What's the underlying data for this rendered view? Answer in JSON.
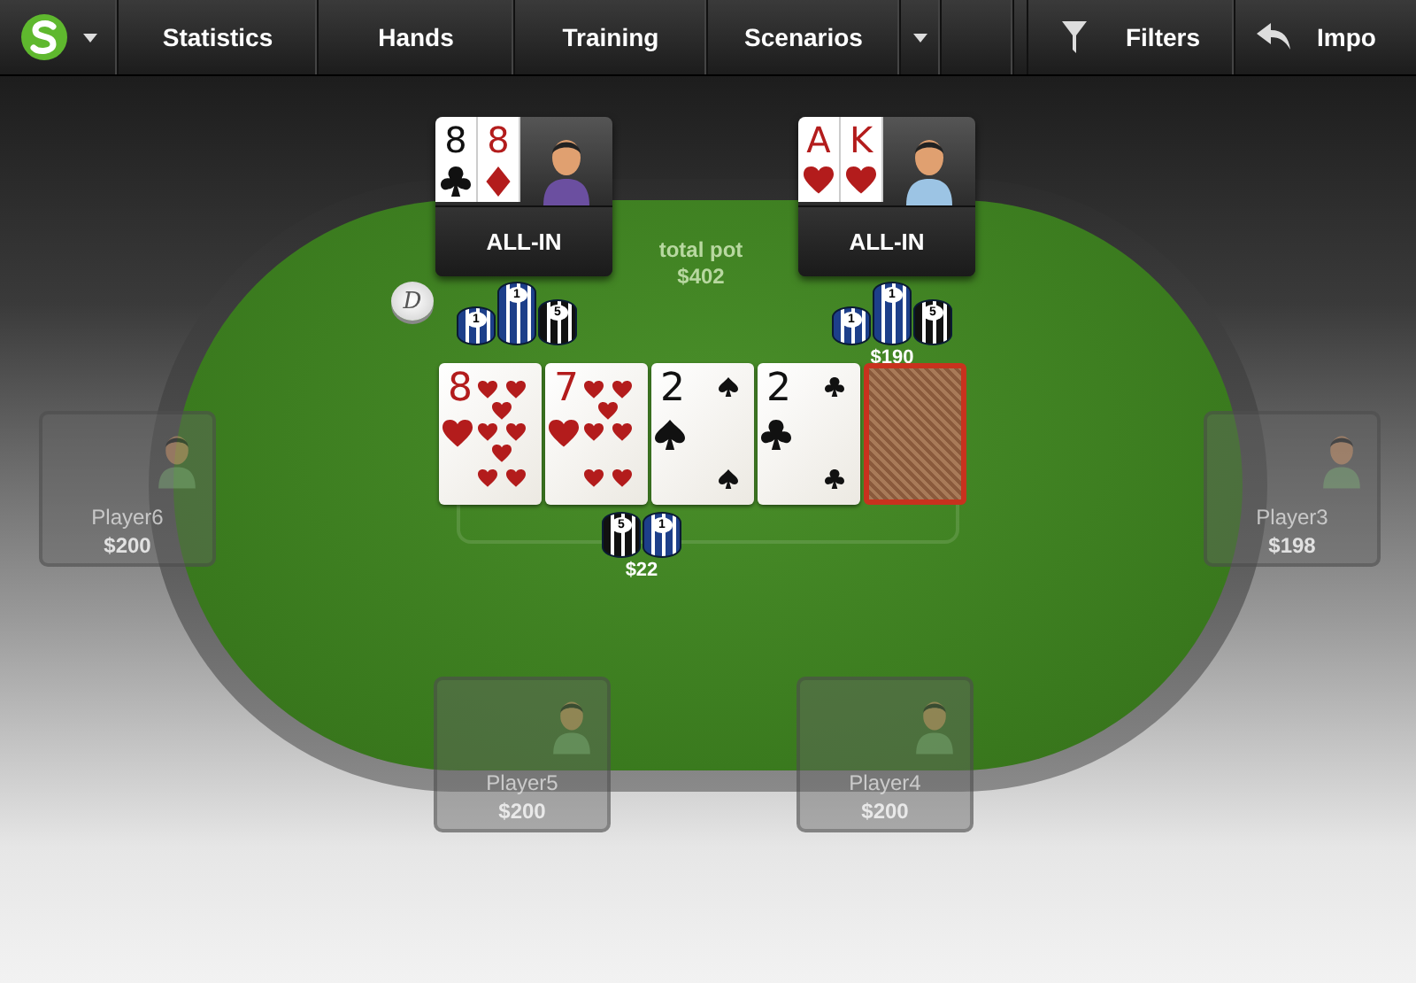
{
  "nav": {
    "items": [
      {
        "label": "Statistics"
      },
      {
        "label": "Hands"
      },
      {
        "label": "Training"
      },
      {
        "label": "Scenarios"
      }
    ],
    "right": [
      {
        "label": "Filters"
      },
      {
        "label": "Impo"
      }
    ]
  },
  "pot": {
    "label": "total pot",
    "amount": "$402"
  },
  "seats": [
    {
      "kind": "hand",
      "status": "ALL-IN",
      "cards": [
        {
          "rank": "8",
          "kind": "clubs"
        },
        {
          "rank": "8",
          "kind": "diamonds"
        }
      ]
    },
    {
      "kind": "hand",
      "status": "ALL-IN",
      "cards": [
        {
          "rank": "A",
          "kind": "hearts"
        },
        {
          "rank": "K",
          "kind": "hearts"
        }
      ]
    },
    {
      "kind": "idle",
      "name": "Player6",
      "stack": "$200"
    },
    {
      "kind": "idle",
      "name": "Player3",
      "stack": "$198"
    },
    {
      "kind": "idle",
      "name": "Player5",
      "stack": "$200"
    },
    {
      "kind": "idle",
      "name": "Player4",
      "stack": "$200"
    }
  ],
  "dealer": {
    "label": "D"
  },
  "bets": [
    {
      "chips": [
        "1",
        "1",
        "5"
      ]
    },
    {
      "chips": [
        "1",
        "1",
        "5"
      ],
      "amount": "$190"
    },
    {
      "chips": [
        "5",
        "1"
      ],
      "amount": "$22"
    }
  ],
  "board": [
    {
      "rank": "8",
      "kind": "hearts"
    },
    {
      "rank": "7",
      "kind": "hearts"
    },
    {
      "rank": "2",
      "kind": "spades"
    },
    {
      "rank": "2",
      "kind": "clubs"
    },
    {
      "kind": "back"
    }
  ]
}
